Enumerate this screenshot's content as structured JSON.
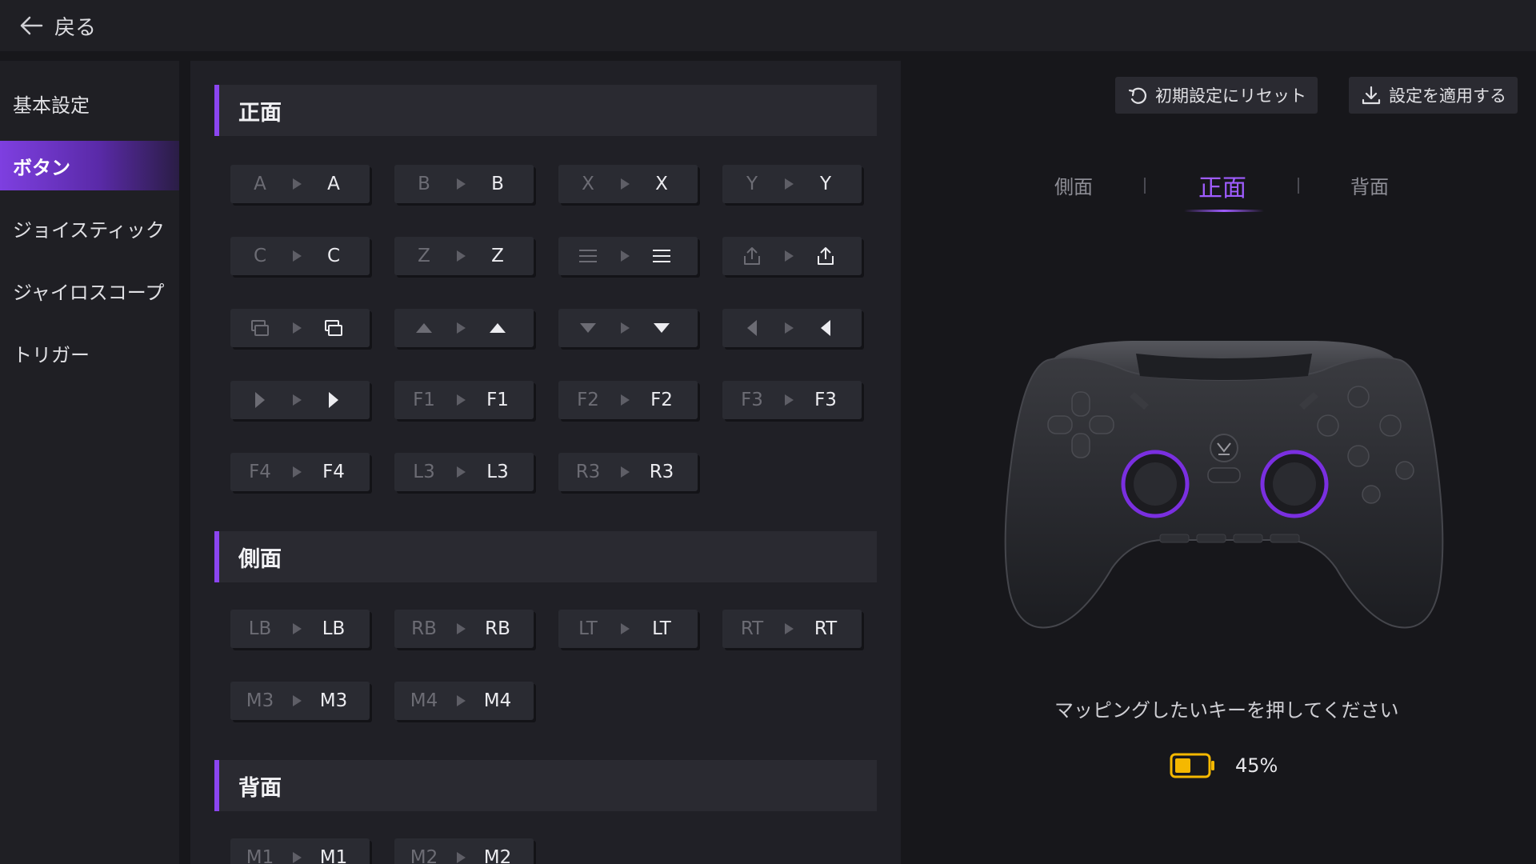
{
  "topbar": {
    "back_label": "戻る"
  },
  "sidebar": {
    "items": [
      {
        "label": "基本設定",
        "active": false
      },
      {
        "label": "ボタン",
        "active": true
      },
      {
        "label": "ジョイスティック",
        "active": false
      },
      {
        "label": "ジャイロスコープ",
        "active": false
      },
      {
        "label": "トリガー",
        "active": false
      }
    ]
  },
  "sections": {
    "front": {
      "title": "正面",
      "keys": [
        {
          "src": "A",
          "dst": "A"
        },
        {
          "src": "B",
          "dst": "B"
        },
        {
          "src": "X",
          "dst": "X"
        },
        {
          "src": "Y",
          "dst": "Y"
        },
        {
          "src": "C",
          "dst": "C"
        },
        {
          "src": "Z",
          "dst": "Z"
        },
        {
          "icon": "menu-icon"
        },
        {
          "icon": "share-icon"
        },
        {
          "icon": "view-icon"
        },
        {
          "icon": "dpad-up-icon"
        },
        {
          "icon": "dpad-down-icon"
        },
        {
          "icon": "dpad-left-icon"
        },
        {
          "icon": "dpad-right-icon"
        },
        {
          "src": "F1",
          "dst": "F1"
        },
        {
          "src": "F2",
          "dst": "F2"
        },
        {
          "src": "F3",
          "dst": "F3"
        },
        {
          "src": "F4",
          "dst": "F4"
        },
        {
          "src": "L3",
          "dst": "L3"
        },
        {
          "src": "R3",
          "dst": "R3"
        }
      ]
    },
    "side": {
      "title": "側面",
      "keys": [
        {
          "src": "LB",
          "dst": "LB"
        },
        {
          "src": "RB",
          "dst": "RB"
        },
        {
          "src": "LT",
          "dst": "LT"
        },
        {
          "src": "RT",
          "dst": "RT"
        },
        {
          "src": "M3",
          "dst": "M3"
        },
        {
          "src": "M4",
          "dst": "M4"
        }
      ]
    },
    "back": {
      "title": "背面",
      "keys": [
        {
          "src": "M1",
          "dst": "M1"
        },
        {
          "src": "M2",
          "dst": "M2"
        }
      ]
    }
  },
  "actions": {
    "reset_label": "初期設定にリセット",
    "apply_label": "設定を適用する"
  },
  "view_tabs": [
    {
      "label": "側面",
      "active": false
    },
    {
      "label": "正面",
      "active": true
    },
    {
      "label": "背面",
      "active": false
    }
  ],
  "status": {
    "hint": "マッピングしたいキーを押してください",
    "battery_percent": "45%"
  },
  "colors": {
    "accent": "#9f5cff",
    "battery": "#f5b800"
  }
}
